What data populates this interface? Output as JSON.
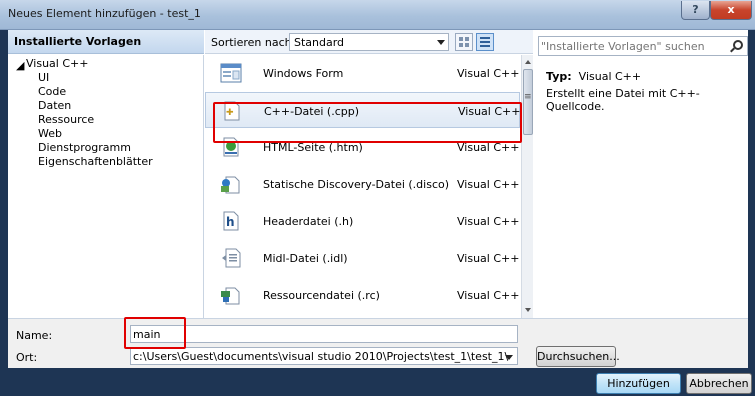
{
  "window": {
    "title": "Neues Element hinzufügen - test_1",
    "help_label": "?",
    "close_label": "x"
  },
  "left_panel": {
    "header": "Installierte Vorlagen",
    "tree": [
      {
        "label": "Visual C++"
      },
      {
        "label": "UI"
      },
      {
        "label": "Code"
      },
      {
        "label": "Daten"
      },
      {
        "label": "Ressource"
      },
      {
        "label": "Web"
      },
      {
        "label": "Dienstprogramm"
      },
      {
        "label": "Eigenschaftenblätter"
      }
    ]
  },
  "toolbar": {
    "sort_label": "Sortieren nach:",
    "sort_value": "Standard"
  },
  "search": {
    "placeholder": "\"Installierte Vorlagen\" suchen"
  },
  "templates": [
    {
      "name": "Windows Form",
      "lang": "Visual C++",
      "icon": "windows-form-icon"
    },
    {
      "name": "C++-Datei (.cpp)",
      "lang": "Visual C++",
      "icon": "cpp-file-icon",
      "selected": true
    },
    {
      "name": "HTML-Seite (.htm)",
      "lang": "Visual C++",
      "icon": "html-page-icon"
    },
    {
      "name": "Statische Discovery-Datei (.disco)",
      "lang": "Visual C++",
      "icon": "disco-file-icon"
    },
    {
      "name": "Headerdatei (.h)",
      "lang": "Visual C++",
      "icon": "header-file-icon"
    },
    {
      "name": "Midl-Datei (.idl)",
      "lang": "Visual C++",
      "icon": "midl-file-icon"
    },
    {
      "name": "Ressourcendatei (.rc)",
      "lang": "Visual C++",
      "icon": "resource-file-icon"
    }
  ],
  "description": {
    "type_label": "Typ:",
    "type_value": "Visual C++",
    "text": "Erstellt eine Datei mit C++-Quellcode."
  },
  "form": {
    "name_label": "Name:",
    "name_value": "main",
    "location_label": "Ort:",
    "location_value": "c:\\Users\\Guest\\documents\\visual studio 2010\\Projects\\test_1\\test_1\\",
    "browse_label": "Durchsuchen..."
  },
  "actions": {
    "add_label": "Hinzufügen",
    "cancel_label": "Abbrechen"
  },
  "colors": {
    "highlight": "#e00000",
    "frame": "#1e3554"
  }
}
